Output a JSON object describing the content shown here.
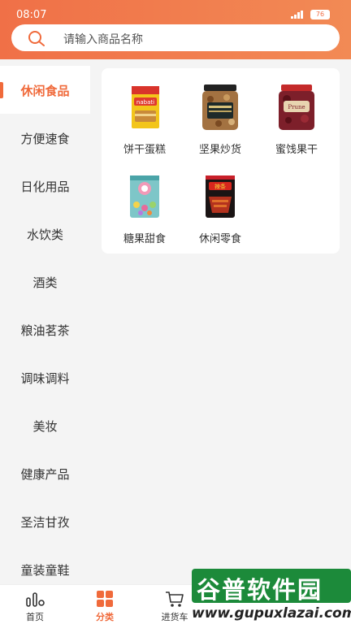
{
  "status_bar": {
    "time": "08:07",
    "battery": "76"
  },
  "search": {
    "placeholder": "请输入商品名称"
  },
  "sidebar": {
    "items": [
      {
        "label": "休闲食品",
        "active": true
      },
      {
        "label": "方便速食"
      },
      {
        "label": "日化用品"
      },
      {
        "label": "水饮类"
      },
      {
        "label": "酒类"
      },
      {
        "label": "粮油茗茶"
      },
      {
        "label": "调味调料"
      },
      {
        "label": "美妆"
      },
      {
        "label": "健康产品"
      },
      {
        "label": "圣洁甘孜"
      },
      {
        "label": "童装童鞋"
      }
    ]
  },
  "categories": [
    {
      "label": "饼干蛋糕",
      "icon": "wafer-product-image"
    },
    {
      "label": "坚果炒货",
      "icon": "nuts-jar-image"
    },
    {
      "label": "蜜饯果干",
      "icon": "dried-fruit-jar-image"
    },
    {
      "label": "糖果甜食",
      "icon": "candy-bag-image"
    },
    {
      "label": "休闲零食",
      "icon": "snack-bag-image"
    }
  ],
  "bottom_nav": {
    "tabs": [
      {
        "label": "首页",
        "icon": "home-icon"
      },
      {
        "label": "分类",
        "icon": "category-grid-icon",
        "active": true
      },
      {
        "label": "进货车",
        "icon": "cart-icon"
      }
    ]
  },
  "watermark": {
    "title": "谷普软件园",
    "url": "www.gupuxlazai.com"
  },
  "colors": {
    "accent": "#f06a3b",
    "header_start": "#f07047",
    "header_end": "#f28a55"
  }
}
